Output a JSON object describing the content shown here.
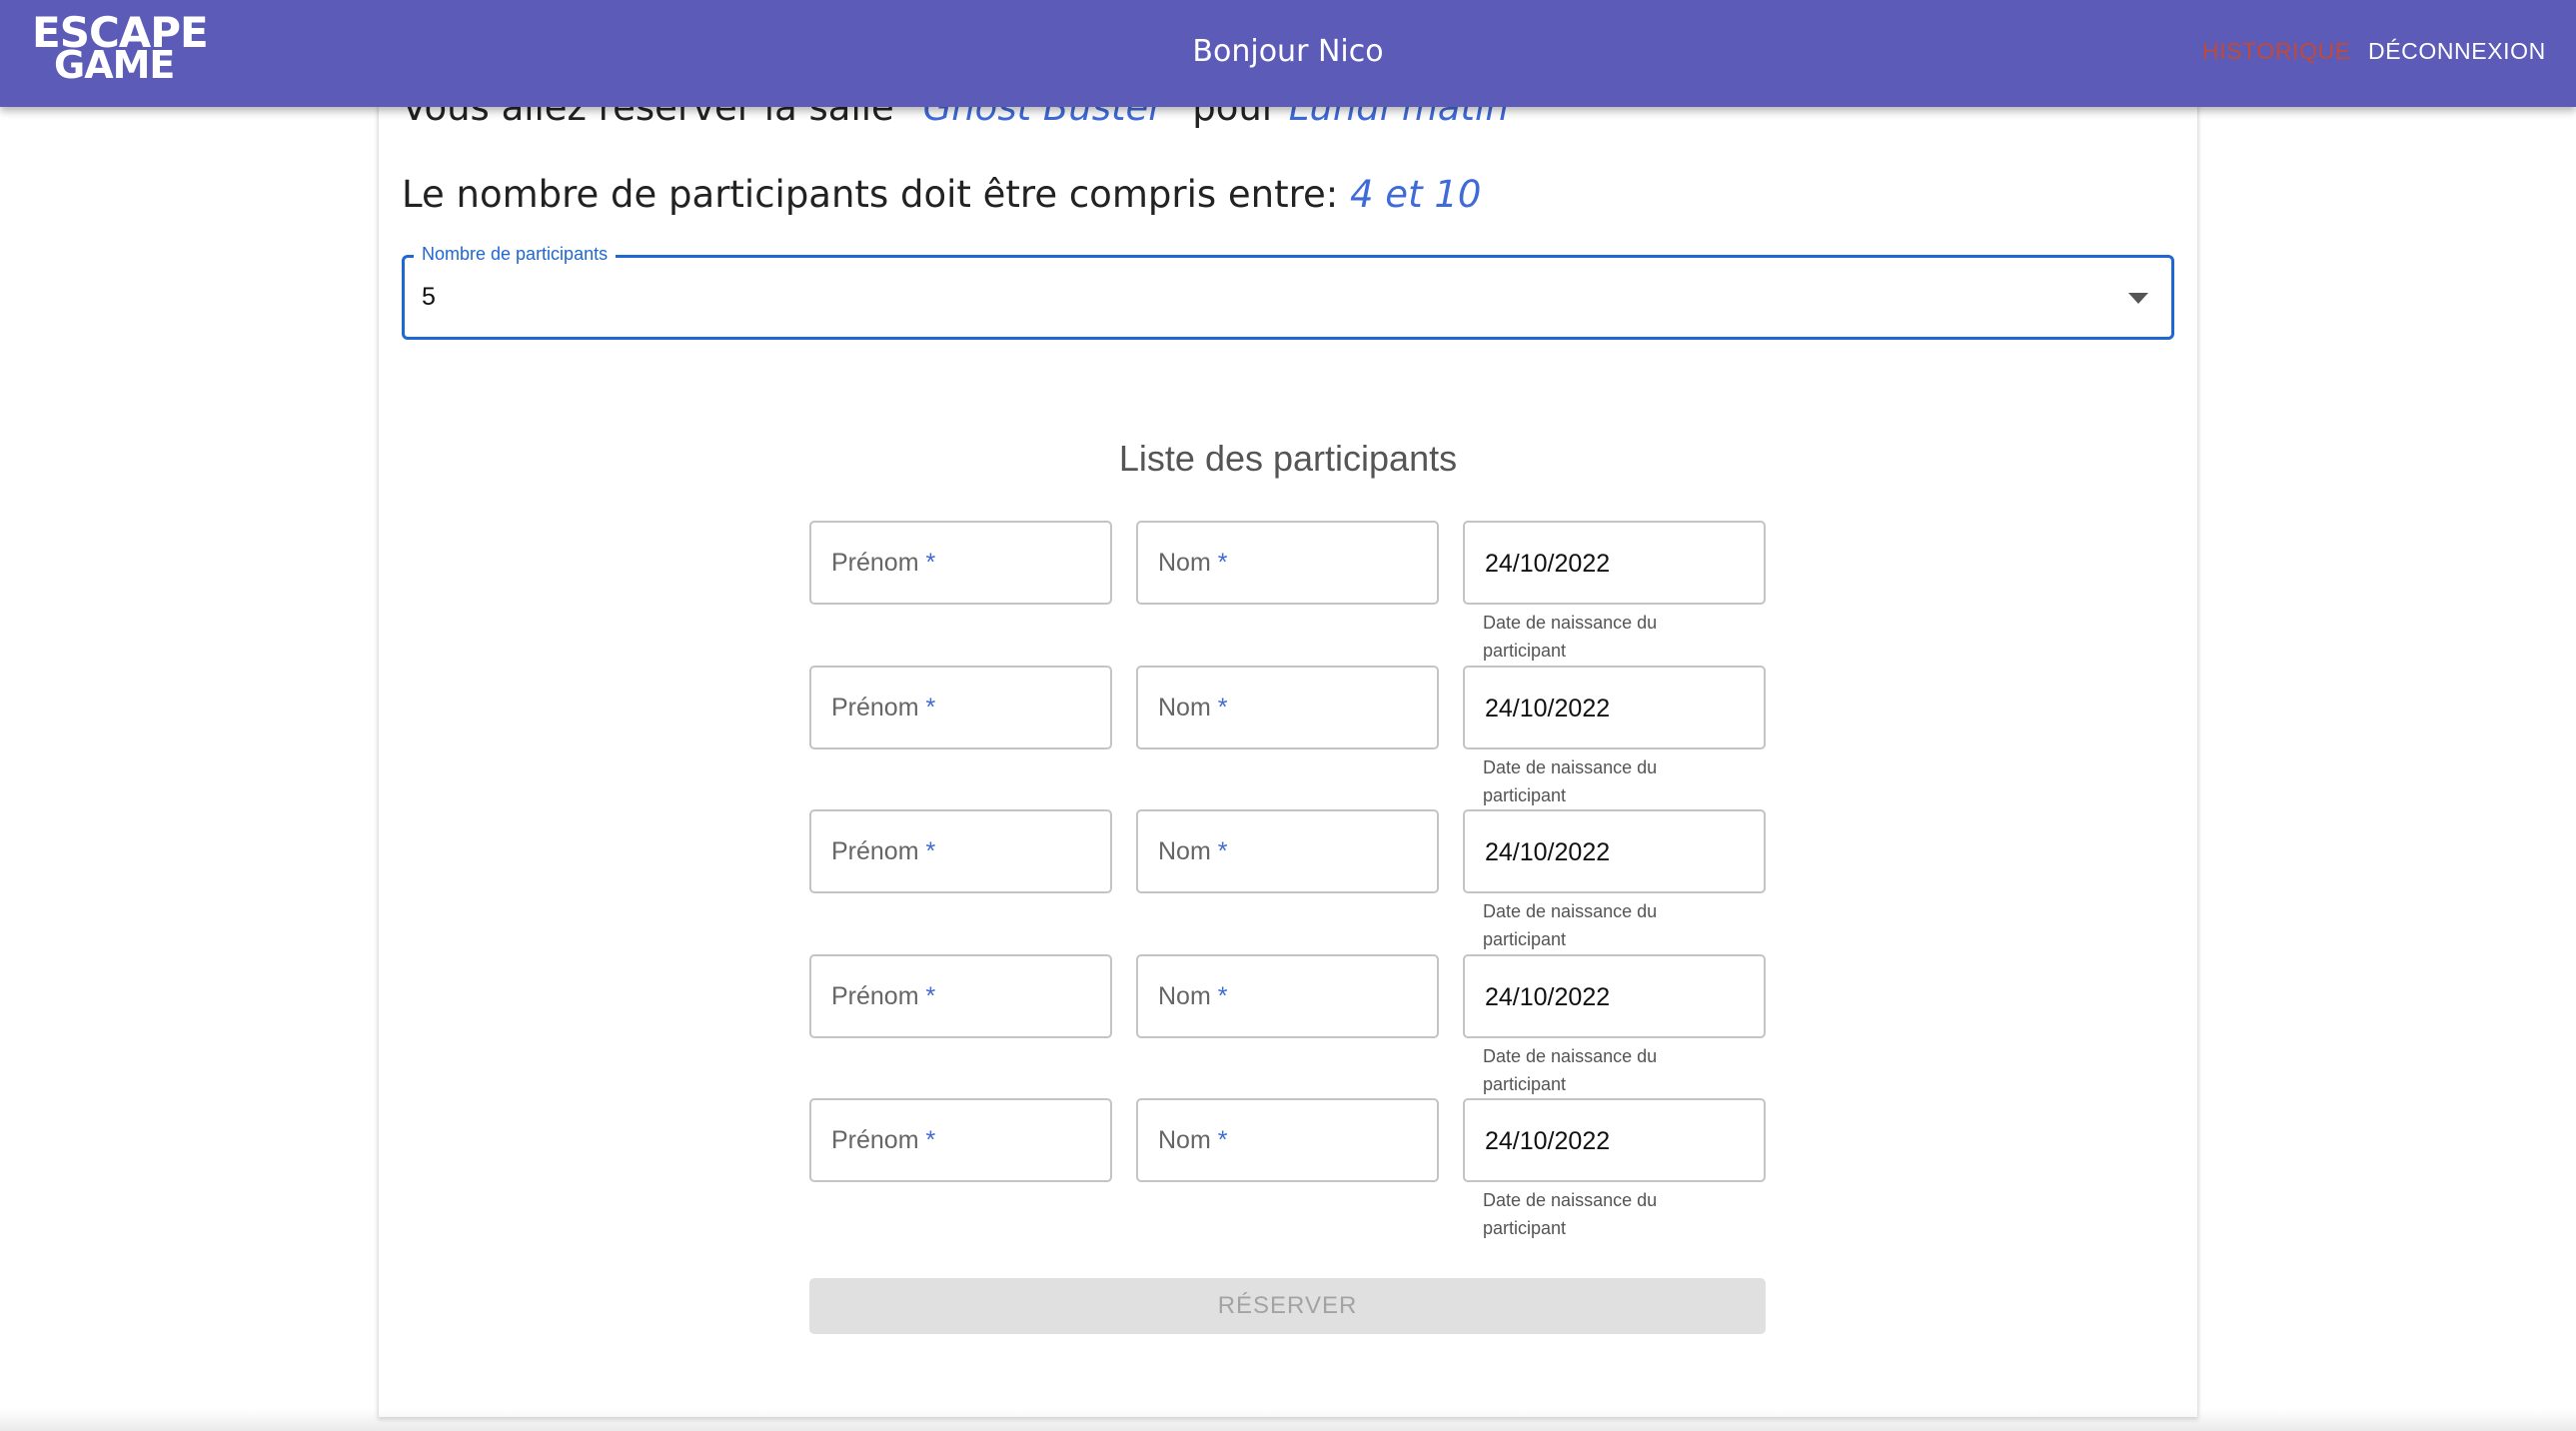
{
  "header": {
    "logo_line1": "ESCAPE",
    "logo_line2": "GAME",
    "greeting": "Bonjour Nico",
    "nav": {
      "historique": "HISTORIQUE",
      "deconnexion": "DÉCONNEXION"
    }
  },
  "booking": {
    "intro_prefix": "Vous allez réserver la salle \"",
    "room": "Ghost Buster",
    "intro_mid": "\" pour ",
    "slot": "Lundi matin",
    "range_prefix": "Le nombre de participants doit être compris entre: ",
    "range": "4 et 10"
  },
  "participants_select": {
    "label": "Nombre de participants",
    "value": "5"
  },
  "participant_list": {
    "title": "Liste des participants",
    "first_name_placeholder": "Prénom",
    "last_name_placeholder": "Nom",
    "required_mark": "*",
    "participants": [
      {
        "birthdate": "24/10/2022",
        "birthdate_helper": "Date de naissance du participant"
      },
      {
        "birthdate": "24/10/2022",
        "birthdate_helper": "Date de naissance du participant"
      },
      {
        "birthdate": "24/10/2022",
        "birthdate_helper": "Date de naissance du participant"
      },
      {
        "birthdate": "24/10/2022",
        "birthdate_helper": "Date de naissance du participant"
      },
      {
        "birthdate": "24/10/2022",
        "birthdate_helper": "Date de naissance du participant"
      }
    ]
  },
  "actions": {
    "submit_label": "RÉSERVER",
    "submit_enabled": false
  },
  "colors": {
    "appbar": "#5c5cb8",
    "accent": "#1f67d2",
    "highlight": "#3f6ad8",
    "nav_active": "#c04a3a"
  }
}
